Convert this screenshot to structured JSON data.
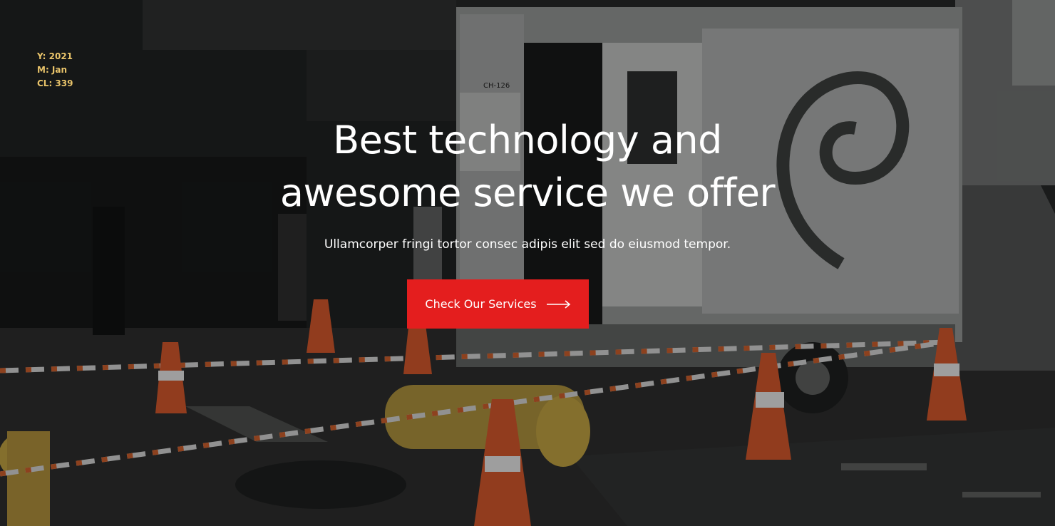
{
  "stamp": {
    "year": "Y: 2021",
    "month": "M: Jan",
    "cl": "CL: 339"
  },
  "hero": {
    "title_line1": "Best technology and",
    "title_line2": "awesome service we offer",
    "subtitle": "Ullamcorper fringi tortor consec adipis elit sed do eiusmod tempor.",
    "cta_label": "Check Our Services",
    "cta_icon": "long-arrow-right-icon",
    "accent_color": "#e41e1e"
  },
  "background": {
    "truck_id_label": "CH-126"
  }
}
